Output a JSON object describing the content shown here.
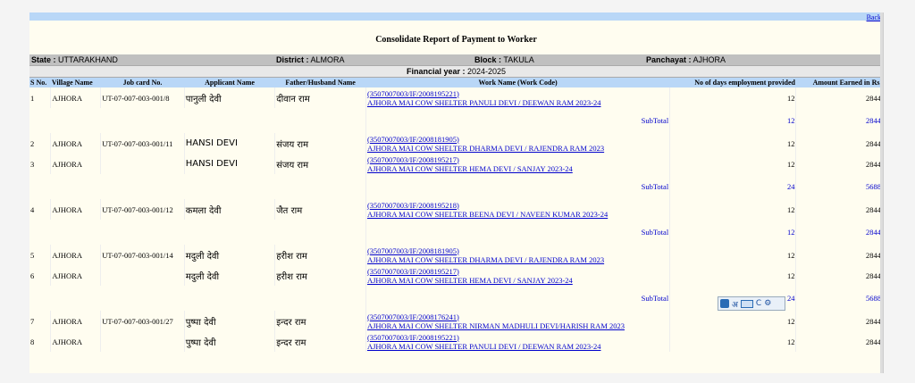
{
  "nav": {
    "back": "Back"
  },
  "report": {
    "title": "Consolidate Report of Payment to Worker"
  },
  "info": {
    "state_label": "State :",
    "state": "UTTARAKHAND",
    "district_label": "District :",
    "district": "ALMORA",
    "block_label": "Block :",
    "block": "TAKULA",
    "panchayat_label": "Panchayat :",
    "panchayat": "AJHORA"
  },
  "fy": {
    "label": "Financial year :",
    "value": "2024-2025"
  },
  "headers": [
    "S No.",
    "Village Name",
    "Job card No.",
    "Applicant Name",
    "Father/Husband Name",
    "Work Name (Work Code)",
    "No of days employment provided",
    "Amount Earned in Rs."
  ],
  "rows": [
    {
      "type": "row",
      "sno": "1",
      "village": "AJHORA",
      "jobcard": "UT-07-007-003-001/8",
      "name": "पानुली देवी",
      "father": "दीवान राम",
      "code": "(3507007003/IF/2008195221)",
      "work": "AJHORA MAI COW SHELTER PANULI DEVI / DEEWAN RAM 2023-24",
      "days": "12",
      "amount": "2844"
    },
    {
      "type": "sub",
      "label": "SubTotal",
      "days": "12",
      "amount": "2844"
    },
    {
      "type": "row",
      "sno": "2",
      "village": "AJHORA",
      "jobcard": "UT-07-007-003-001/11",
      "name": "HANSI DEVI",
      "father": "संजय राम",
      "code": "(3507007003/IF/2008181905)",
      "work": "AJHORA MAI COW SHELTER DHARMA DEVI / RAJENDRA RAM 2023",
      "days": "12",
      "amount": "2844"
    },
    {
      "type": "row",
      "sno": "3",
      "village": "AJHORA",
      "jobcard": "",
      "name": "HANSI DEVI",
      "father": "संजय राम",
      "code": "(3507007003/IF/2008195217)",
      "work": "AJHORA MAI COW SHELTER HEMA DEVI / SANJAY 2023-24",
      "days": "12",
      "amount": "2844"
    },
    {
      "type": "sub",
      "label": "SubTotal",
      "days": "24",
      "amount": "5688"
    },
    {
      "type": "row",
      "sno": "4",
      "village": "AJHORA",
      "jobcard": "UT-07-007-003-001/12",
      "name": "कमला देवी",
      "father": "जैत राम",
      "code": "(3507007003/IF/2008195218)",
      "work": "AJHORA MAI COW SHELTER BEENA DEVI / NAVEEN KUMAR 2023-24",
      "days": "12",
      "amount": "2844"
    },
    {
      "type": "sub",
      "label": "SubTotal",
      "days": "12",
      "amount": "2844"
    },
    {
      "type": "row",
      "sno": "5",
      "village": "AJHORA",
      "jobcard": "UT-07-007-003-001/14",
      "name": "मदुली देवी",
      "father": "हरीश राम",
      "code": "(3507007003/IF/2008181905)",
      "work": "AJHORA MAI COW SHELTER DHARMA DEVI / RAJENDRA RAM 2023",
      "days": "12",
      "amount": "2844"
    },
    {
      "type": "row",
      "sno": "6",
      "village": "AJHORA",
      "jobcard": "",
      "name": "मदुली देवी",
      "father": "हरीश राम",
      "code": "(3507007003/IF/2008195217)",
      "work": "AJHORA MAI COW SHELTER HEMA DEVI / SANJAY 2023-24",
      "days": "12",
      "amount": "2844"
    },
    {
      "type": "sub",
      "label": "SubTotal",
      "days": "24",
      "amount": "5688"
    },
    {
      "type": "row",
      "sno": "7",
      "village": "AJHORA",
      "jobcard": "UT-07-007-003-001/27",
      "name": "पुष्पा देवी",
      "father": "इन्दर राम",
      "code": "(3507007003/IF/2008176241)",
      "work": "AJHORA MAI COW SHELTER NIRMAN MADHULI DEVI/HARISH RAM 2023",
      "days": "12",
      "amount": "2844"
    },
    {
      "type": "row",
      "sno": "8",
      "village": "AJHORA",
      "jobcard": "",
      "name": "पुष्पा देवी",
      "father": "इन्दर राम",
      "code": "(3507007003/IF/2008195221)",
      "work": "AJHORA MAI COW SHELTER PANULI DEVI / DEEWAN RAM 2023-24",
      "days": "12",
      "amount": "2844"
    }
  ],
  "widget": {
    "script_glyph": "अ",
    "c_label": "C",
    "icons": [
      "translate-icon",
      "keyboard-icon",
      "gear-icon"
    ]
  }
}
